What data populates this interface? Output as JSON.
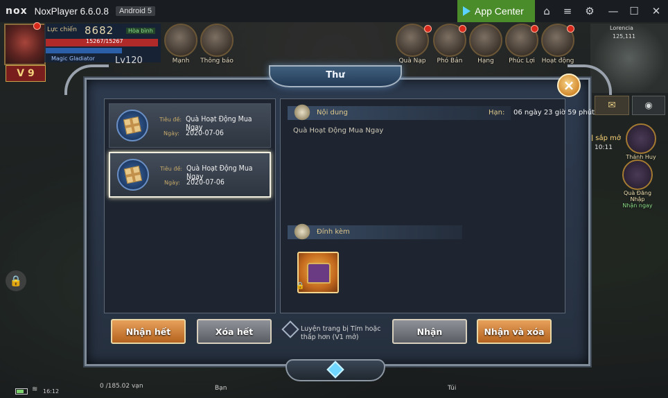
{
  "window": {
    "logo": "nox",
    "title": "NoxPlayer 6.6.0.8",
    "android_badge": "Android 5",
    "app_center": "App Center",
    "controls": [
      "home-icon",
      "menu-icon",
      "settings-icon",
      "minimize-icon",
      "maximize-icon",
      "close-icon"
    ]
  },
  "hud": {
    "level": "V 9",
    "power_label": "Lực chiến",
    "power_value": "8682",
    "peace_tag": "Hòa bình",
    "hp_text": "15267/15267",
    "guild": "Magic Gladiator",
    "lv": "Lv120",
    "top_icons": [
      {
        "label": "Mạnh",
        "icon": "upgrade-icon"
      },
      {
        "label": "Thông báo",
        "icon": "notice-icon"
      },
      {
        "label": "Quà Nạp",
        "icon": "gift-icon"
      },
      {
        "label": "Phó Bản",
        "icon": "sword-icon"
      },
      {
        "label": "Hạng",
        "icon": "rank-icon"
      },
      {
        "label": "Phúc Lợi",
        "icon": "chest-icon"
      },
      {
        "label": "Hoạt động",
        "icon": "event-icon"
      }
    ],
    "map_name": "Lorencia",
    "map_coord": "125,111",
    "event_open": "[uy] sắp mở",
    "event_time": "10:11",
    "side_thanhhuy": "Thánh Huy",
    "side_quadang": "Quà Đăng Nhập",
    "side_quadang_sub": "Nhận ngay",
    "exp_text": "0 /185.02 vạn",
    "bottom_ban": "Bạn",
    "bottom_tui": "Túi",
    "clock": "16:12"
  },
  "dialog": {
    "title": "Thư",
    "close_icon": "close-icon",
    "list_title_label": "Tiêu đề:",
    "list_date_label": "Ngày:",
    "mails": [
      {
        "title": "Quà Hoạt Động Mua Ngay",
        "date": "2020-07-06",
        "selected": false
      },
      {
        "title": "Quà Hoạt Động Mua Ngay",
        "date": "2020-07-06",
        "selected": true
      }
    ],
    "content_head": "Nội dung",
    "deadline_label": "Hạn:",
    "deadline_value": "06 ngày 23 giờ 59 phút",
    "content_text": "Quà Hoạt Động Mua Ngay",
    "attach_head": "Đính kèm",
    "attach_icon": "treasure-chest-icon",
    "buttons": {
      "receive_all": "Nhận hết",
      "delete_all": "Xóa hết",
      "receive": "Nhận",
      "receive_delete": "Nhận và xóa"
    },
    "auto_label": "Luyện trang bị Tím hoặc thấp hơn (V1 mở)"
  }
}
